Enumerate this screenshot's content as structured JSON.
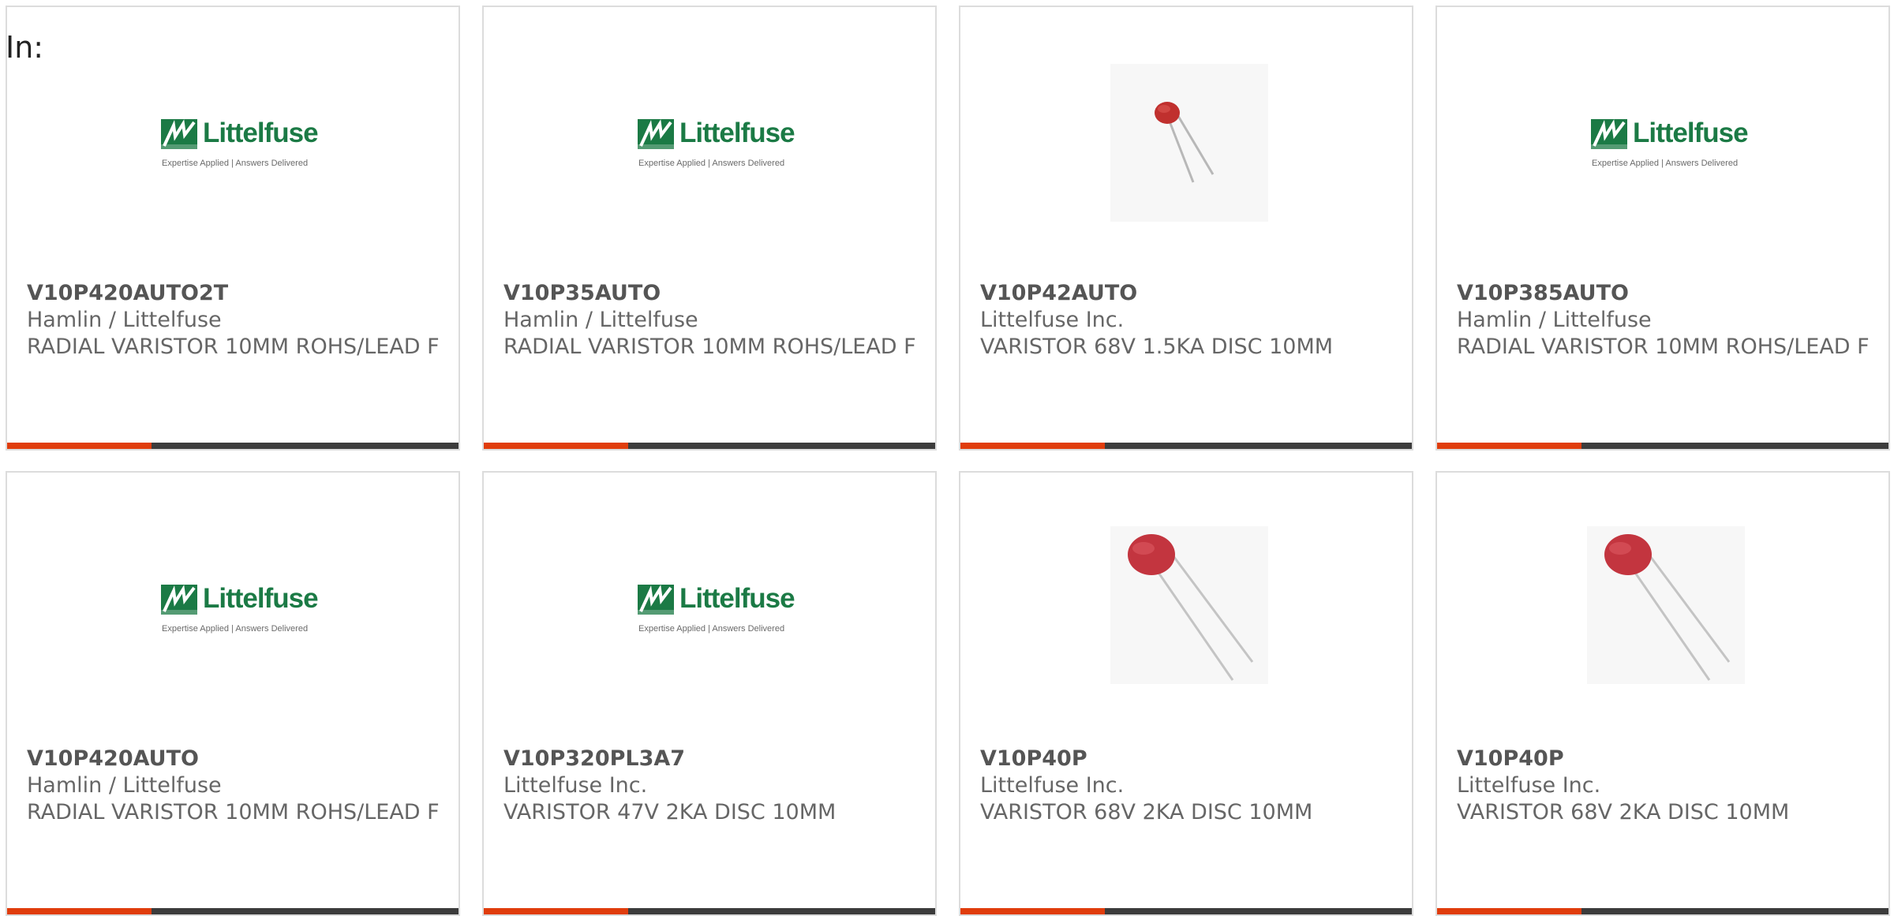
{
  "filter_label": "In:",
  "brand": {
    "name": "Littelfuse",
    "tagline": "Expertise Applied | Answers Delivered",
    "color": "#1b7a45"
  },
  "accent_color": "#e03d0c",
  "products": [
    {
      "part_number": "V10P420AUTO2T",
      "manufacturer": "Hamlin / Littelfuse",
      "description": "RADIAL VARISTOR 10MM ROHS/LEAD F",
      "image": "littelfuse-logo"
    },
    {
      "part_number": "V10P35AUTO",
      "manufacturer": "Hamlin / Littelfuse",
      "description": "RADIAL VARISTOR 10MM ROHS/LEAD F",
      "image": "littelfuse-logo"
    },
    {
      "part_number": "V10P42AUTO",
      "manufacturer": "Littelfuse Inc.",
      "description": "VARISTOR 68V 1.5KA DISC 10MM",
      "image": "varistor-photo-small"
    },
    {
      "part_number": "V10P385AUTO",
      "manufacturer": "Hamlin / Littelfuse",
      "description": "RADIAL VARISTOR 10MM ROHS/LEAD F",
      "image": "littelfuse-logo"
    },
    {
      "part_number": "V10P420AUTO",
      "manufacturer": "Hamlin / Littelfuse",
      "description": "RADIAL VARISTOR 10MM ROHS/LEAD F",
      "image": "littelfuse-logo"
    },
    {
      "part_number": "V10P320PL3A7",
      "manufacturer": "Littelfuse Inc.",
      "description": "VARISTOR 47V 2KA DISC 10MM",
      "image": "littelfuse-logo"
    },
    {
      "part_number": "V10P40P",
      "manufacturer": "Littelfuse Inc.",
      "description": "VARISTOR 68V 2KA DISC 10MM",
      "image": "varistor-photo"
    },
    {
      "part_number": "V10P40P",
      "manufacturer": "Littelfuse Inc.",
      "description": "VARISTOR 68V 2KA DISC 10MM",
      "image": "varistor-photo"
    }
  ]
}
